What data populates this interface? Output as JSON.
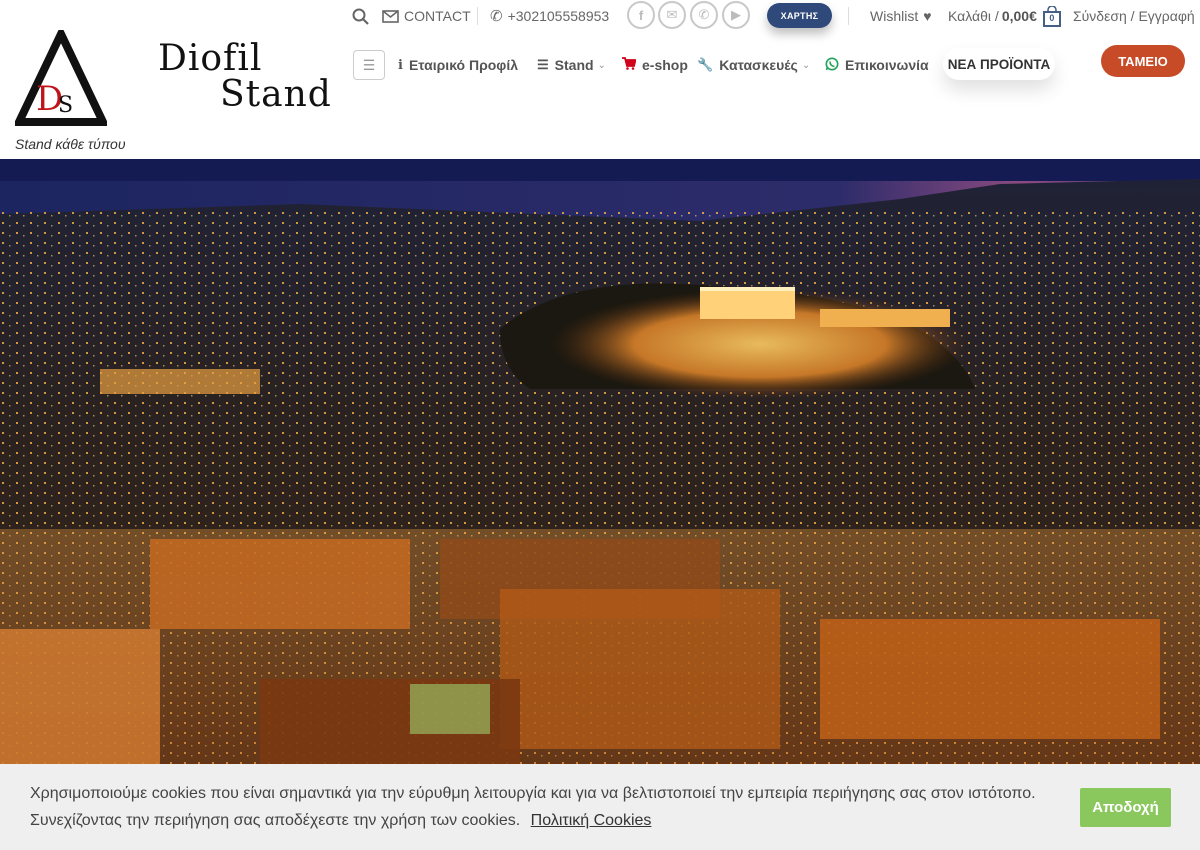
{
  "topbar": {
    "contact_label": "CONTACT",
    "phone": "+302105558953",
    "social": [
      "facebook-icon",
      "email-icon",
      "phone-icon",
      "youtube-icon"
    ],
    "map_button": "ΧΑΡΤΗΣ",
    "wishlist_label": "Wishlist",
    "cart_label": "Καλάθι /",
    "cart_total": "0,00€",
    "cart_count": "0",
    "login_label": "Σύνδεση / Εγγραφή"
  },
  "logo": {
    "monogram": "DS",
    "line1": "Diofil",
    "line2": "Stand",
    "tagline": "Stand κάθε τύπου"
  },
  "nav": {
    "items": [
      {
        "label": "Εταιρικό Προφίλ",
        "icon": "info-icon",
        "dropdown": false
      },
      {
        "label": "Stand",
        "icon": "list-icon",
        "dropdown": true
      },
      {
        "label": "e-shop",
        "icon": "cart-icon",
        "dropdown": false
      },
      {
        "label": "Κατασκευές",
        "icon": "wrench-icon",
        "dropdown": true
      },
      {
        "label": "Επικοινωνία",
        "icon": "whatsapp-icon",
        "dropdown": false
      }
    ],
    "new_products": "ΝΕΑ ΠΡΟΪΟΝΤΑ",
    "checkout": "ΤΑΜΕΙΟ"
  },
  "cookie": {
    "text": "Χρησιμοποιούμε cookies που είναι σημαντικά για την εύρυθμη λειτουργία και για να βελτιστοποιεί την εμπειρία περιήγησης σας στον ιστότοπο. Συνεχίζοντας την περιήγηση σας αποδέχεστε την χρήση των cookies.",
    "policy_link": "Πολιτική Cookies",
    "accept": "Αποδοχή"
  },
  "colors": {
    "accent": "#c84b27",
    "map_button": "#2f4a7a",
    "accept": "#8ac85e",
    "cart_red": "#d0021b"
  }
}
